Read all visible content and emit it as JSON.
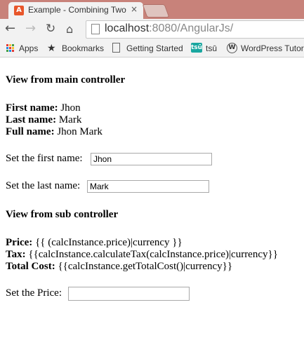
{
  "browser": {
    "tab_title": "Example - Combining Two",
    "tab_close": "×",
    "url_host": "localhost",
    "url_rest": ":8080/AngularJs/",
    "bookmarks": [
      "Apps",
      "Bookmarks",
      "Getting Started",
      "tsū",
      "WordPress Tutori"
    ],
    "favicon_letter": "A",
    "tsu_icon_text": "tsū"
  },
  "main": {
    "heading": "View from main controller",
    "first_name_label": "First name:",
    "first_name_value": "Jhon",
    "last_name_label": "Last name:",
    "last_name_value": "Mark",
    "full_name_label": "Full name:",
    "full_name_value": "Jhon Mark",
    "set_first_label": "Set the first name:",
    "first_input_value": "Jhon",
    "set_last_label": "Set the last name:",
    "last_input_value": "Mark"
  },
  "sub": {
    "heading": "View from sub controller",
    "price_label": "Price:",
    "price_value": "{{ (calcInstance.price)|currency }}",
    "tax_label": "Tax:",
    "tax_value": "{{calcInstance.calculateTax(calcInstance.price)|currency}}",
    "total_label": "Total Cost:",
    "total_value": "{{calcInstance.getTotalCost()|currency}}",
    "set_price_label": "Set the Price:",
    "price_input_value": ""
  }
}
